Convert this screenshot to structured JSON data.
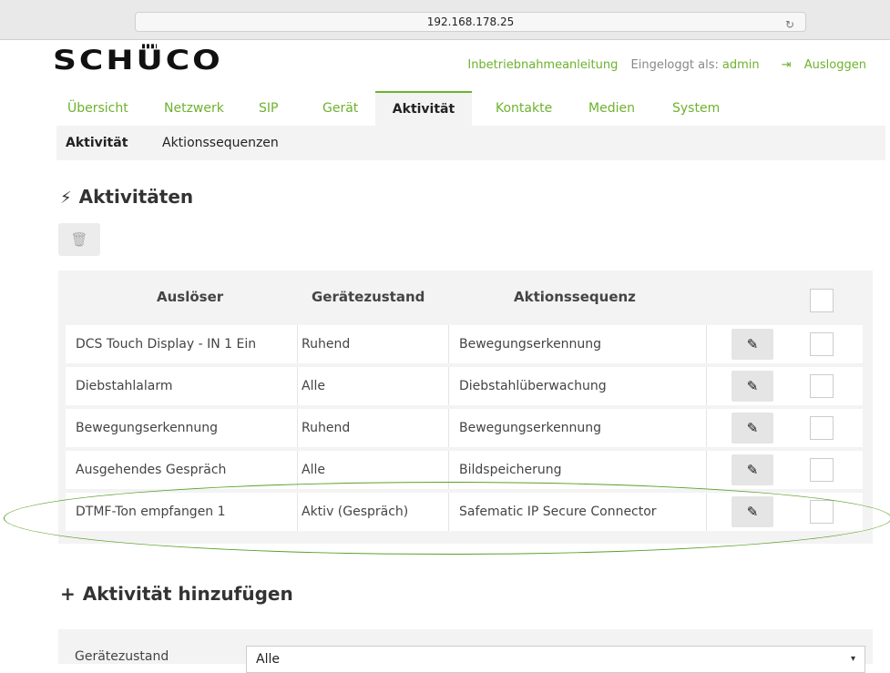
{
  "browser": {
    "url": "192.168.178.25"
  },
  "header": {
    "logo": "SCHÜCO",
    "setup_link": "Inbetriebnahmeanleitung",
    "logged_in_label": "Eingeloggt als:",
    "user": "admin",
    "logout": "Ausloggen"
  },
  "nav": {
    "tabs": [
      "Übersicht",
      "Netzwerk",
      "SIP",
      "Gerät",
      "Aktivität",
      "Kontakte",
      "Medien",
      "System"
    ],
    "active": "Aktivität"
  },
  "subnav": {
    "items": [
      "Aktivität",
      "Aktionssequenzen"
    ],
    "active": "Aktivität"
  },
  "section": {
    "title": "Aktivitäten"
  },
  "table": {
    "headers": [
      "Auslöser",
      "Gerätezustand",
      "Aktionssequenz"
    ],
    "rows": [
      {
        "trigger": "DCS Touch Display - IN 1 Ein",
        "state": "Ruhend",
        "sequence": "Bewegungserkennung"
      },
      {
        "trigger": "Diebstahlalarm",
        "state": "Alle",
        "sequence": "Diebstahlüberwachung"
      },
      {
        "trigger": "Bewegungserkennung",
        "state": "Ruhend",
        "sequence": "Bewegungserkennung"
      },
      {
        "trigger": "Ausgehendes Gespräch",
        "state": "Alle",
        "sequence": "Bildspeicherung"
      },
      {
        "trigger": "DTMF-Ton empfangen 1",
        "state": "Aktiv (Gespräch)",
        "sequence": "Safematic IP Secure Connector"
      }
    ]
  },
  "add_section": {
    "title": "Aktivität hinzufügen"
  },
  "form": {
    "state_label": "Gerätezustand",
    "state_value": "Alle"
  },
  "colors": {
    "accent": "#6db22d",
    "panel": "#f3f3f3",
    "highlight_ellipse": "#5aa02a"
  }
}
